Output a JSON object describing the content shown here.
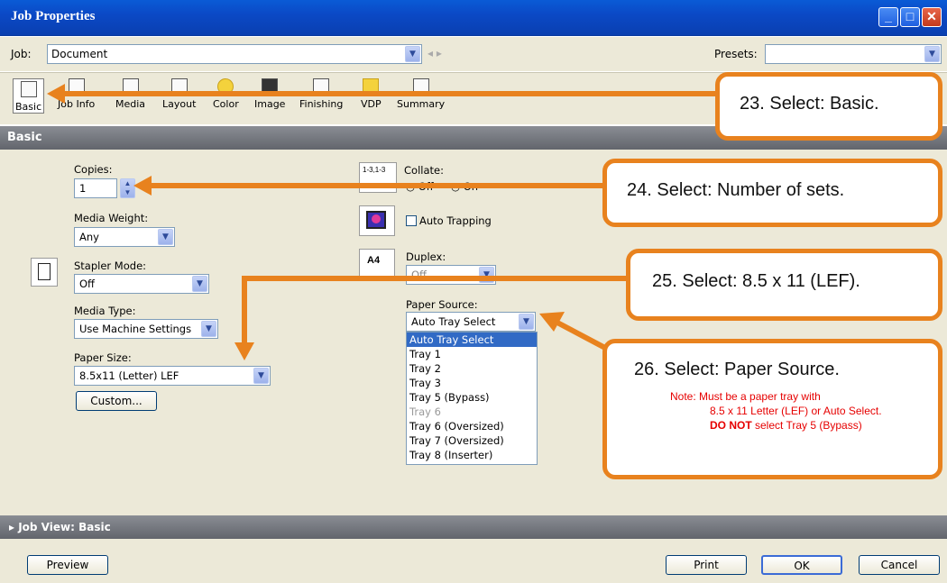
{
  "window": {
    "title": "Job Properties",
    "min": "_",
    "max": "□",
    "close": "✕"
  },
  "jobrow": {
    "job_label": "Job:",
    "job_value": "Document",
    "presets_label": "Presets:",
    "presets_value": ""
  },
  "toolbar": {
    "items": [
      "Basic",
      "Job Info",
      "Media",
      "Layout",
      "Color",
      "Image",
      "Finishing",
      "VDP",
      "Summary"
    ]
  },
  "section": {
    "title": "Basic"
  },
  "form": {
    "copies_label": "Copies:",
    "copies_value": "1",
    "media_weight_label": "Media Weight:",
    "media_weight_value": "Any",
    "stapler_label": "Stapler Mode:",
    "stapler_value": "Off",
    "media_type_label": "Media Type:",
    "media_type_value": "Use Machine Settings",
    "paper_size_label": "Paper Size:",
    "paper_size_value": "8.5x11 (Letter) LEF",
    "custom_button": "Custom...",
    "collate_label": "Collate:",
    "collate_icon_text": "1-3,1-3",
    "collate_off": "Off",
    "collate_on": "On",
    "auto_trapping_label": "Auto Trapping",
    "duplex_label": "Duplex:",
    "duplex_value": "Off",
    "duplex_icon_text": "A4",
    "paper_source_label": "Paper Source:",
    "paper_source_value": "Auto Tray Select",
    "paper_source_options": [
      "Auto Tray Select",
      "Tray 1",
      "Tray 2",
      "Tray 3",
      "Tray 5 (Bypass)",
      "Tray 6",
      "Tray 6 (Oversized)",
      "Tray 7 (Oversized)",
      "Tray 8 (Inserter)"
    ]
  },
  "jobview": {
    "label": "Job View: Basic"
  },
  "footer": {
    "preview": "Preview",
    "print": "Print",
    "ok": "OK",
    "cancel": "Cancel"
  },
  "callouts": {
    "c23": "23.  Select: Basic.",
    "c24": "24. Select:  Number of sets.",
    "c25": "25. Select: 8.5 x 11 (LEF).",
    "c26": "26. Select: Paper Source.",
    "note_line1": "Note: Must be a paper tray with",
    "note_line2": "8.5 x 11 Letter (LEF) or Auto Select.",
    "note_bold": "DO NOT",
    "note_line3": " select Tray 5 (Bypass)"
  },
  "colors": {
    "accent_orange": "#e8821e",
    "title_blue": "#0b49c6",
    "note_red": "#e60000"
  }
}
